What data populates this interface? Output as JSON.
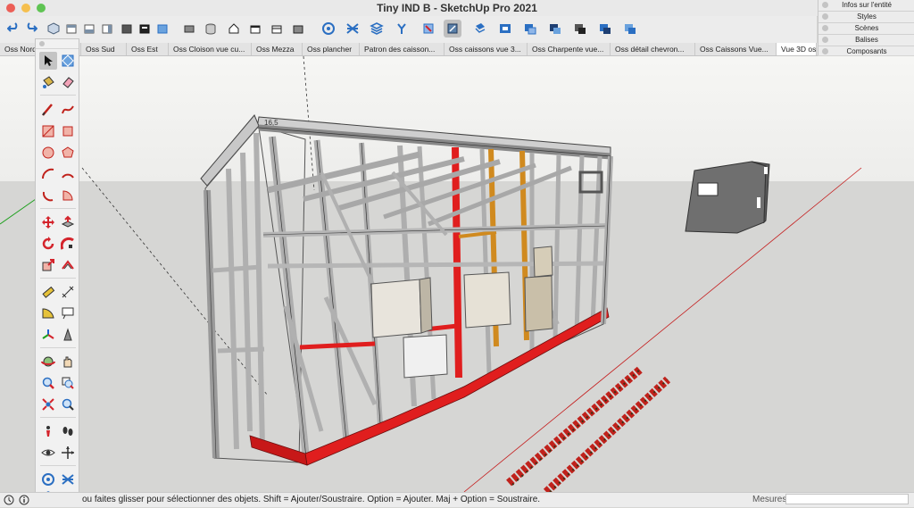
{
  "window": {
    "title": "Tiny IND B - SketchUp Pro 2021"
  },
  "tray": {
    "items": [
      "Infos sur l'entité",
      "Styles",
      "Scènes",
      "Balises",
      "Composants"
    ]
  },
  "scene_tabs": [
    {
      "label": "Oss Nord",
      "active": false
    },
    {
      "label": "Oss Sud",
      "active": false
    },
    {
      "label": "Oss Est",
      "active": false
    },
    {
      "label": "Oss Cloison vue cu...",
      "active": false
    },
    {
      "label": "Oss Mezza",
      "active": false
    },
    {
      "label": "Oss plancher",
      "active": false
    },
    {
      "label": "Patron des caisson...",
      "active": false
    },
    {
      "label": "Oss caissons vue 3...",
      "active": false
    },
    {
      "label": "Oss Charpente vue...",
      "active": false
    },
    {
      "label": "Oss détail chevron...",
      "active": false
    },
    {
      "label": "Oss Caissons Vue...",
      "active": false
    },
    {
      "label": "Vue 3D os",
      "active": true
    }
  ],
  "model": {
    "dimension_label": "16,5"
  },
  "statusbar": {
    "hint": "ou faites glisser pour sélectionner des objets. Shift = Ajouter/Soustraire. Option = Ajouter. Maj + Option = Soustraire.",
    "measurements_label": "Mesures",
    "measurements_value": ""
  },
  "colors": {
    "frame": "#b8b8b8",
    "red_beam": "#e01e1e",
    "orange_stud": "#d08a1f",
    "axis_red": "#c41a1a",
    "axis_green": "#1ea01e",
    "sky": "#f4f4f2",
    "ground": "#d6d6d4"
  },
  "toolbar_icons": [
    "undo-icon",
    "redo-icon",
    "iso-view-icon",
    "top-view-icon",
    "front-view-icon",
    "right-view-icon",
    "back-view-icon",
    "left-view-icon",
    "bottom-view-icon",
    "xray-icon",
    "back-edges-icon",
    "wireframe-icon",
    "hidden-line-icon",
    "shaded-icon",
    "shaded-textures-icon",
    "monochrome-icon",
    "solid-tools-icon",
    "outer-shell-icon",
    "intersect-icon",
    "union-icon",
    "subtract-icon",
    "trim-icon",
    "split-icon",
    "section-plane-icon",
    "section-display-icon",
    "section-cut-icon",
    "section-fill-icon",
    "component-icon",
    "layer-icon",
    "add-location-icon",
    "warehouse-icon",
    "extension-icon",
    "share-icon",
    "send-icon"
  ],
  "palette_tools": [
    "select-icon",
    "make-component-icon",
    "paint-bucket-icon",
    "eraser-icon",
    "pencil-icon",
    "freehand-icon",
    "rectangle-icon",
    "rotated-rectangle-icon",
    "circle-icon",
    "polygon-icon",
    "arc-icon",
    "arc-2pt-icon",
    "arc-3pt-icon",
    "pie-icon",
    "move-icon",
    "push-pull-icon",
    "rotate-icon",
    "follow-me-icon",
    "scale-icon",
    "offset-icon",
    "tape-measure-icon",
    "dimensions-icon",
    "protractor-icon",
    "text-icon",
    "axes-icon",
    "3d-text-icon",
    "orbit-icon",
    "pan-icon",
    "zoom-icon",
    "zoom-window-icon",
    "zoom-extents-icon",
    "previous-view-icon",
    "position-camera-icon",
    "walk-icon",
    "look-around-icon",
    "section-plane-icon",
    "solid-tools-icon",
    "outliner-icon"
  ]
}
